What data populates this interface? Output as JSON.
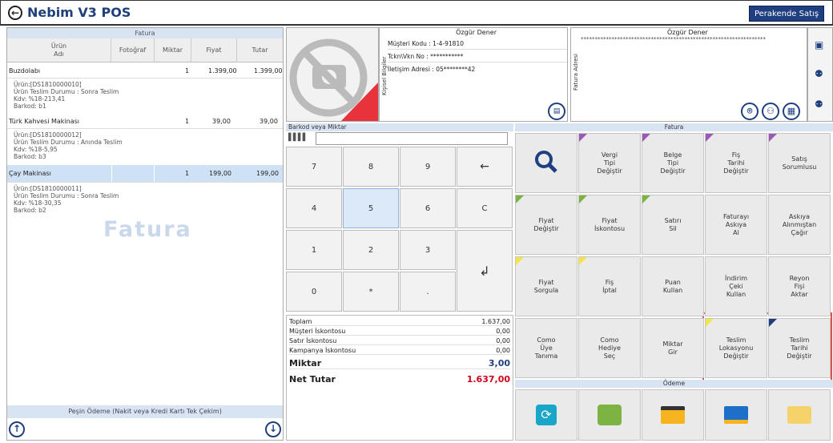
{
  "app": {
    "title": "Nebim V3 POS",
    "mode_button": "Perakende Satış"
  },
  "left": {
    "header": "Fatura",
    "columns": [
      "Ürün\nAdı",
      "Fotoğraf",
      "Miktar",
      "Fiyat",
      "Tutar"
    ],
    "items": [
      {
        "name": "Buzdolabı",
        "qty": "1",
        "price": "1.399,00",
        "total": "1.399,00",
        "details": [
          "Ürün:[DS1810000010]",
          "Ürün Teslim Durumu : Sonra Teslim",
          "Kdv: %18-213,41",
          "Barkod: b1"
        ]
      },
      {
        "name": "Türk Kahvesi Makinası",
        "qty": "1",
        "price": "39,00",
        "total": "39,00",
        "details": [
          "Ürün:[DS1810000012]",
          "Ürün Teslim Durumu : Anında Teslim",
          "Kdv: %18-5,95",
          "Barkod: b3"
        ]
      },
      {
        "name": "Çay Makinası",
        "qty": "1",
        "price": "199,00",
        "total": "199,00",
        "details": [
          "Ürün:[DS1810000011]",
          "Ürün Teslim Durumu : Sonra Teslim",
          "Kdv: %18-30,35",
          "Barkod: b2"
        ]
      }
    ],
    "watermark": "Fatura",
    "footer": "Peşin Ödeme (Nakit veya Kredi Kartı Tek Çekim)"
  },
  "customer": {
    "name": "Özgür Dener",
    "code": "Müşteri Kodu : 1-4-91810",
    "tckn": "Tckn\\Vkn No : ***********",
    "address": "İletişim Adresi : 05********42",
    "side_label": "Kişisel Bilgiler",
    "invoice_side_label": "Fatura Adresi",
    "invoice_name": "Özgür Dener",
    "invoice_masked": "******************************************************************"
  },
  "keypad": {
    "label": "Barkod veya Miktar",
    "keys": [
      "7",
      "8",
      "9",
      "←",
      "4",
      "5",
      "6",
      "C",
      "1",
      "2",
      "3",
      "0",
      "*",
      ".",
      "↲"
    ]
  },
  "totals": [
    {
      "label": "Toplam",
      "value": "1.637,00"
    },
    {
      "label": "Müşteri İskontosu",
      "value": "0,00"
    },
    {
      "label": "Satır İskontosu",
      "value": "0,00"
    },
    {
      "label": "Kampanya İskontosu",
      "value": "0,00"
    },
    {
      "label": "Miktar",
      "value": "3,00"
    },
    {
      "label": "Net Tutar",
      "value": "1.637,00"
    }
  ],
  "fatura_header": "Fatura",
  "odeme_header": "Ödeme",
  "buttons": [
    "",
    "Vergi\nTipi\nDeğiştir",
    "Belge\nTipi\nDeğiştir",
    "Fiş\nTarihi\nDeğiştir",
    "Satış\nSorumlusu",
    "Fiyat\nDeğiştir",
    "Fiyat\nİskontosu",
    "Satırı\nSil",
    "Faturayı\nAskıya\nAl",
    "Askıya\nAlınmıştan\nÇağır",
    "Fiyat\nSorgula",
    "Fiş\nİptal",
    "Puan\nKullan",
    "İndirim\nÇeki\nKullan",
    "Reyon\nFişi\nAktar",
    "Como\nÜye\nTanıma",
    "Como\nHediye\nSeç",
    "Miktar\nGir",
    "Teslim\nLokasyonu\nDeğiştir",
    "Teslim\nTarihi\nDeğiştir"
  ],
  "pay_icons": [
    "refresh-icon",
    "cash-icon",
    "credit-card-icon",
    "gift-card-icon",
    "card-icon"
  ],
  "colors": {
    "brand": "#1f3f80",
    "net_total": "#d0021b",
    "highlight": "#d9534f"
  }
}
